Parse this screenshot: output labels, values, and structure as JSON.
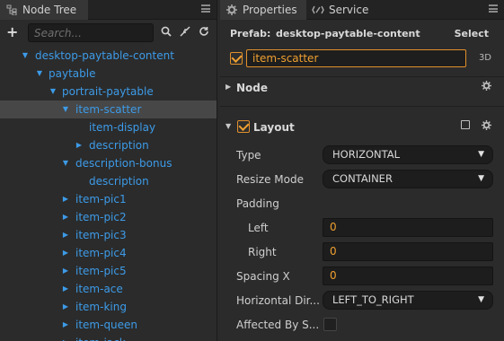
{
  "node_tree": {
    "tab_label": "Node Tree",
    "icon": "tree-icon",
    "search_placeholder": "Search...",
    "items": [
      {
        "label": "desktop-paytable-content",
        "expanded": true
      },
      {
        "label": "paytable",
        "expanded": true
      },
      {
        "label": "portrait-paytable",
        "expanded": true
      },
      {
        "label": "item-scatter",
        "expanded": true,
        "selected": true
      },
      {
        "label": "item-display"
      },
      {
        "label": "description",
        "expanded": false
      },
      {
        "label": "description-bonus",
        "expanded": true
      },
      {
        "label": "description"
      },
      {
        "label": "item-pic1",
        "expanded": false
      },
      {
        "label": "item-pic2",
        "expanded": false
      },
      {
        "label": "item-pic3",
        "expanded": false
      },
      {
        "label": "item-pic4",
        "expanded": false
      },
      {
        "label": "item-pic5",
        "expanded": false
      },
      {
        "label": "item-ace",
        "expanded": false
      },
      {
        "label": "item-king",
        "expanded": false
      },
      {
        "label": "item-queen",
        "expanded": false
      },
      {
        "label": "item-jack",
        "expanded": false
      }
    ]
  },
  "properties": {
    "tabs": [
      {
        "label": "Properties",
        "icon": "gear-icon",
        "active": true
      },
      {
        "label": "Service",
        "icon": "service-icon",
        "active": false
      }
    ],
    "prefab_label": "Prefab:",
    "prefab_name": "desktop-paytable-content",
    "select_label": "Select",
    "node_name": "item-scatter",
    "node_active": true,
    "mode_label": "3D",
    "node_section": "Node",
    "layout_section": "Layout",
    "layout_enabled": true,
    "fields": {
      "type": {
        "label": "Type",
        "value": "HORIZONTAL"
      },
      "resize_mode": {
        "label": "Resize Mode",
        "value": "CONTAINER"
      },
      "padding": {
        "label": "Padding"
      },
      "left": {
        "label": "Left",
        "value": "0"
      },
      "right": {
        "label": "Right",
        "value": "0"
      },
      "spacing_x": {
        "label": "Spacing X",
        "value": "0"
      },
      "horizontal_direction": {
        "label": "Horizontal Dir...",
        "value": "LEFT_TO_RIGHT"
      },
      "affected_by_scale": {
        "label": "Affected By S...",
        "checked": false
      }
    }
  },
  "colors": {
    "tree_text": "#3d9be8",
    "accent_orange": "#f0a030",
    "selection": "#474747",
    "panel_bg": "#2b2b2b"
  }
}
